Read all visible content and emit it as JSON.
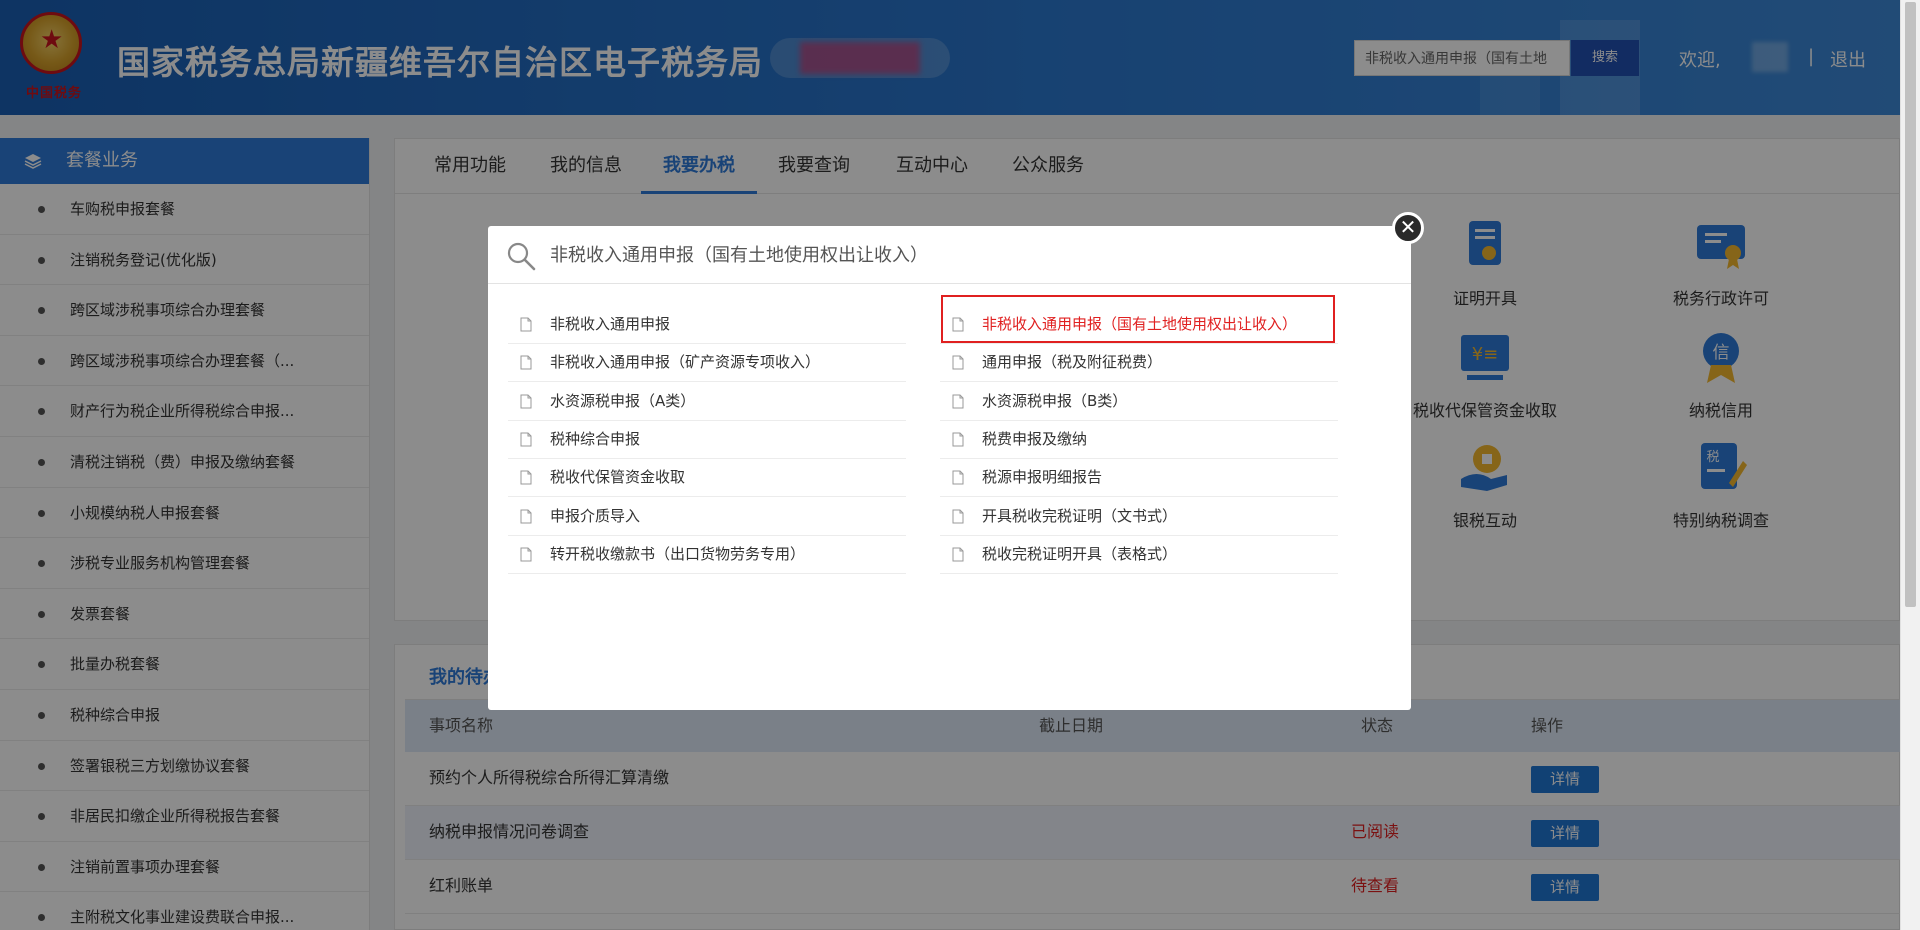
{
  "header": {
    "org_title": "国家税务总局新疆维吾尔自治区电子税务局",
    "emblem_text": "中国税务",
    "search_value": "非税收入通用申报（国有土地",
    "search_button": "搜索",
    "welcome": "欢迎,",
    "separator": "|",
    "logout": "退出"
  },
  "sidebar": {
    "title": "套餐业务",
    "items": [
      "车购税申报套餐",
      "注销税务登记(优化版)",
      "跨区域涉税事项综合办理套餐",
      "跨区域涉税事项综合办理套餐（...",
      "财产行为税企业所得税综合申报...",
      "清税注销税（费）申报及缴纳套餐",
      "小规模纳税人申报套餐",
      "涉税专业服务机构管理套餐",
      "发票套餐",
      "批量办税套餐",
      "税种综合申报",
      "签署银税三方划缴协议套餐",
      "非居民扣缴企业所得税报告套餐",
      "注销前置事项办理套餐",
      "主附税文化事业建设费联合申报..."
    ]
  },
  "main": {
    "tabs": [
      "常用功能",
      "我的信息",
      "我要办税",
      "我要查询",
      "互动中心",
      "公众服务"
    ],
    "active_tab": 2,
    "tiles": [
      {
        "label": "证明开具",
        "icon": "certificate-icon"
      },
      {
        "label": "税务行政许可",
        "icon": "license-icon"
      },
      {
        "label": "税收代保管资金收取",
        "icon": "fund-custody-icon"
      },
      {
        "label": "纳税信用",
        "icon": "credit-badge-icon"
      },
      {
        "label": "银税互动",
        "icon": "bank-tax-icon"
      },
      {
        "label": "特别纳税调查",
        "icon": "tax-investigation-icon"
      }
    ]
  },
  "todo": {
    "tab_label": "我的待办",
    "columns": [
      "事项名称",
      "截止日期",
      "状态",
      "操作"
    ],
    "rows": [
      {
        "name": "预约个人所得税综合所得汇算清缴",
        "deadline": "",
        "status": "",
        "action": "详情"
      },
      {
        "name": "纳税申报情况问卷调查",
        "deadline": "",
        "status": "已阅读",
        "action": "详情"
      },
      {
        "name": "红利账单",
        "deadline": "",
        "status": "待查看",
        "action": "详情"
      }
    ]
  },
  "modal": {
    "search_value": "非税收入通用申报（国有土地使用权出让收入）",
    "close_symbol": "✕",
    "left_results": [
      "非税收入通用申报",
      "非税收入通用申报（矿产资源专项收入）",
      "水资源税申报（A类）",
      "税种综合申报",
      "税收代保管资金收取",
      "申报介质导入",
      "转开税收缴款书（出口货物劳务专用）"
    ],
    "right_results": [
      "非税收入通用申报（国有土地使用权出让收入）",
      "通用申报（税及附征税费）",
      "水资源税申报（B类）",
      "税费申报及缴纳",
      "税源申报明细报告",
      "开具税收完税证明（文书式）",
      "税收完税证明开具（表格式）"
    ],
    "highlighted_right_index": 0
  },
  "colors": {
    "header_blue": "#1a5fb4",
    "accent_blue": "#2f7bd9",
    "highlight_red": "#e02020",
    "button_blue": "#2077d4"
  }
}
